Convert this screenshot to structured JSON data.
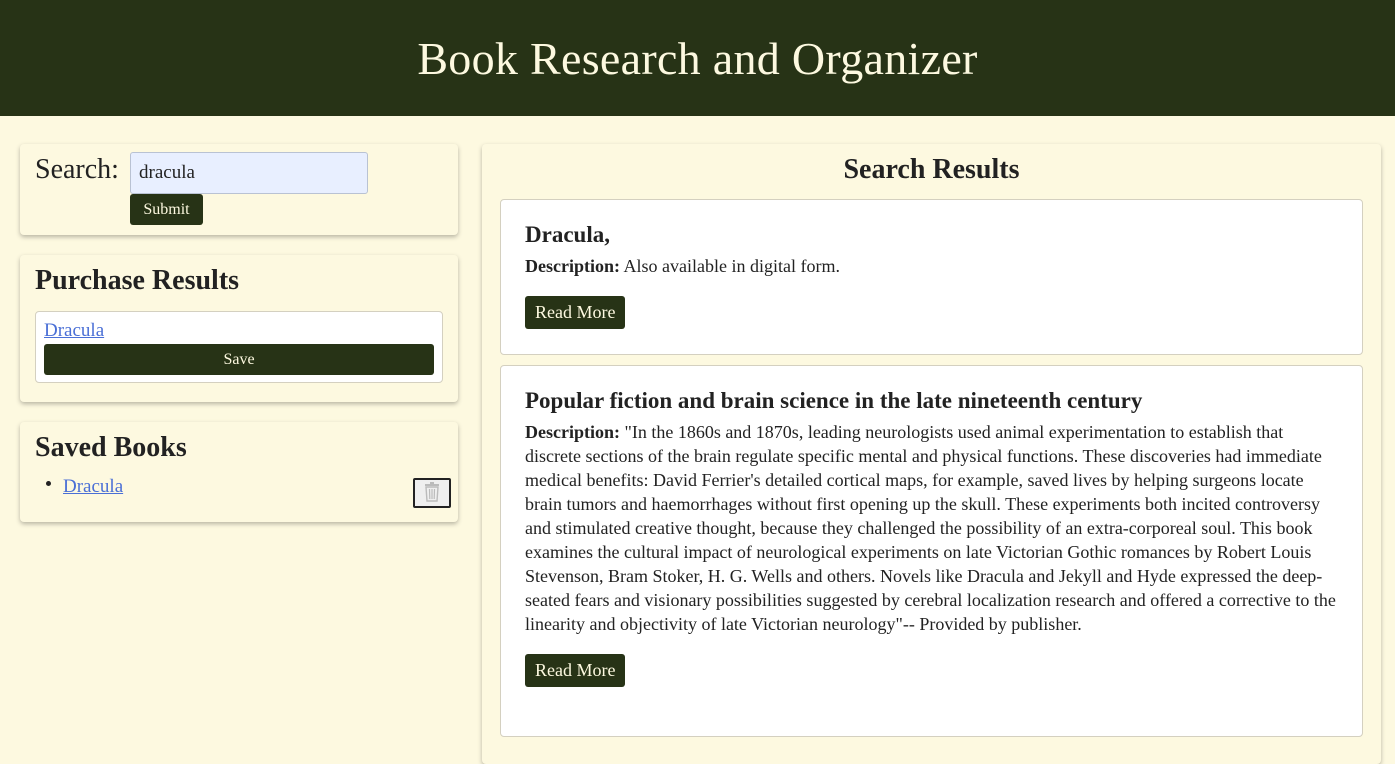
{
  "header": {
    "title": "Book Research and Organizer"
  },
  "search": {
    "label": "Search:",
    "value": "dracula",
    "submit_label": "Submit"
  },
  "purchase": {
    "title": "Purchase Results",
    "items": [
      {
        "link": "Dracula",
        "save_label": "Save"
      }
    ]
  },
  "saved": {
    "title": "Saved Books",
    "items": [
      {
        "link": "Dracula",
        "delete_icon": "trash-icon"
      }
    ]
  },
  "results": {
    "title": "Search Results",
    "description_label": "Description:",
    "read_more_label": "Read More",
    "items": [
      {
        "title": "Dracula,",
        "description": "Also available in digital form."
      },
      {
        "title": "Popular fiction and brain science in the late nineteenth century",
        "description": "\"In the 1860s and 1870s, leading neurologists used animal experimentation to establish that discrete sections of the brain regulate specific mental and physical functions. These discoveries had immediate medical benefits: David Ferrier's detailed cortical maps, for example, saved lives by helping surgeons locate brain tumors and haemorrhages without first opening up the skull. These experiments both incited controversy and stimulated creative thought, because they challenged the possibility of an extra-corporeal soul. This book examines the cultural impact of neurological experiments on late Victorian Gothic romances by Robert Louis Stevenson, Bram Stoker, H. G. Wells and others. Novels like Dracula and Jekyll and Hyde expressed the deep-seated fears and visionary possibilities suggested by cerebral localization research and offered a corrective to the linearity and objectivity of late Victorian neurology\"-- Provided by publisher."
      }
    ]
  },
  "colors": {
    "header_bg": "#273316",
    "page_bg": "#fdf9e0",
    "link": "#4a6fd6",
    "input_bg": "#e8efff"
  }
}
